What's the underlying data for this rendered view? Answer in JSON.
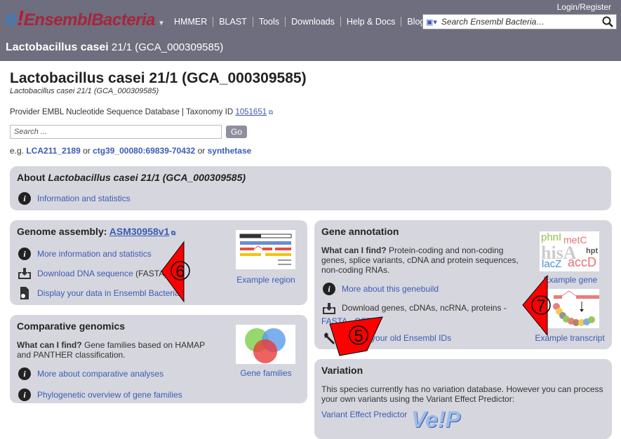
{
  "header": {
    "logo_e": "e",
    "logo_excl": "!",
    "logo_text": "EnsemblBacteria",
    "logo_caret": "▼",
    "nav": [
      "HMMER",
      "BLAST",
      "Tools",
      "Downloads",
      "Help & Docs",
      "Blog"
    ],
    "login": "Login/Register",
    "search_placeholder": "Search Ensembl Bacteria…"
  },
  "subheader": {
    "species": "Lactobacillus casei",
    "strain": "21/1 (GCA_000309585)"
  },
  "page": {
    "title": "Lactobacillus casei 21/1 (GCA_000309585)",
    "subtitle": "Lactobacillus casei 21/1 (GCA_000309585)",
    "provider_text": "Provider EMBL Nucleotide Sequence Database | Taxonomy ID",
    "taxonomy_id": "1051651",
    "search_placeholder": "Search ...",
    "go": "Go",
    "eg_prefix": "e.g.",
    "eg1": "LCA211_2189",
    "or1": "or",
    "eg2": "ctg39_00080:69839-70432",
    "or2": "or",
    "eg3": "synthetase"
  },
  "about": {
    "title_prefix": "About",
    "title_species": "Lactobacillus casei 21/1 (GCA_000309585)",
    "link": "Information and statistics"
  },
  "assembly": {
    "title": "Genome assembly:",
    "assembly_link": "ASM30958v1",
    "link1": "More information and statistics",
    "link2": "Download DNA sequence",
    "link2_suffix": "(FASTA)",
    "link3": "Display your data in Ensembl Bacteria",
    "example": "Example region"
  },
  "comparative": {
    "title": "Comparative genomics",
    "wcf": "What can I find?",
    "desc": "Gene families based on HAMAP and PANTHER classification.",
    "link1": "More about comparative analyses",
    "link2": "Phylogenetic overview of gene families",
    "example": "Gene families"
  },
  "gene": {
    "title": "Gene annotation",
    "wcf": "What can I find?",
    "desc": "Protein-coding and non-coding genes, splice variants, cDNA and protein sequences, non-coding RNAs.",
    "link1": "More about this genebuild",
    "download_text": "Download genes, cDNAs, ncRNA, proteins -",
    "fasta": "FASTA",
    "dash": "-",
    "gff3": "GFF3",
    "link3": "Update your old Ensembl IDs",
    "example_gene": "Example gene",
    "example_transcript": "Example transcript",
    "wordcloud": [
      "phnI",
      "metC",
      "hisA",
      "hpt",
      "lacZ",
      "accD"
    ]
  },
  "variation": {
    "title": "Variation",
    "desc": "This species currently has no variation database. However you can process your own variants using the Variant Effect Predictor:",
    "link": "Variant Effect Predictor",
    "vep_logo": "VEP"
  },
  "annotations": {
    "arrow6": "6",
    "arrow7": "7",
    "arrow5": "5",
    "color": "#ff0000"
  }
}
